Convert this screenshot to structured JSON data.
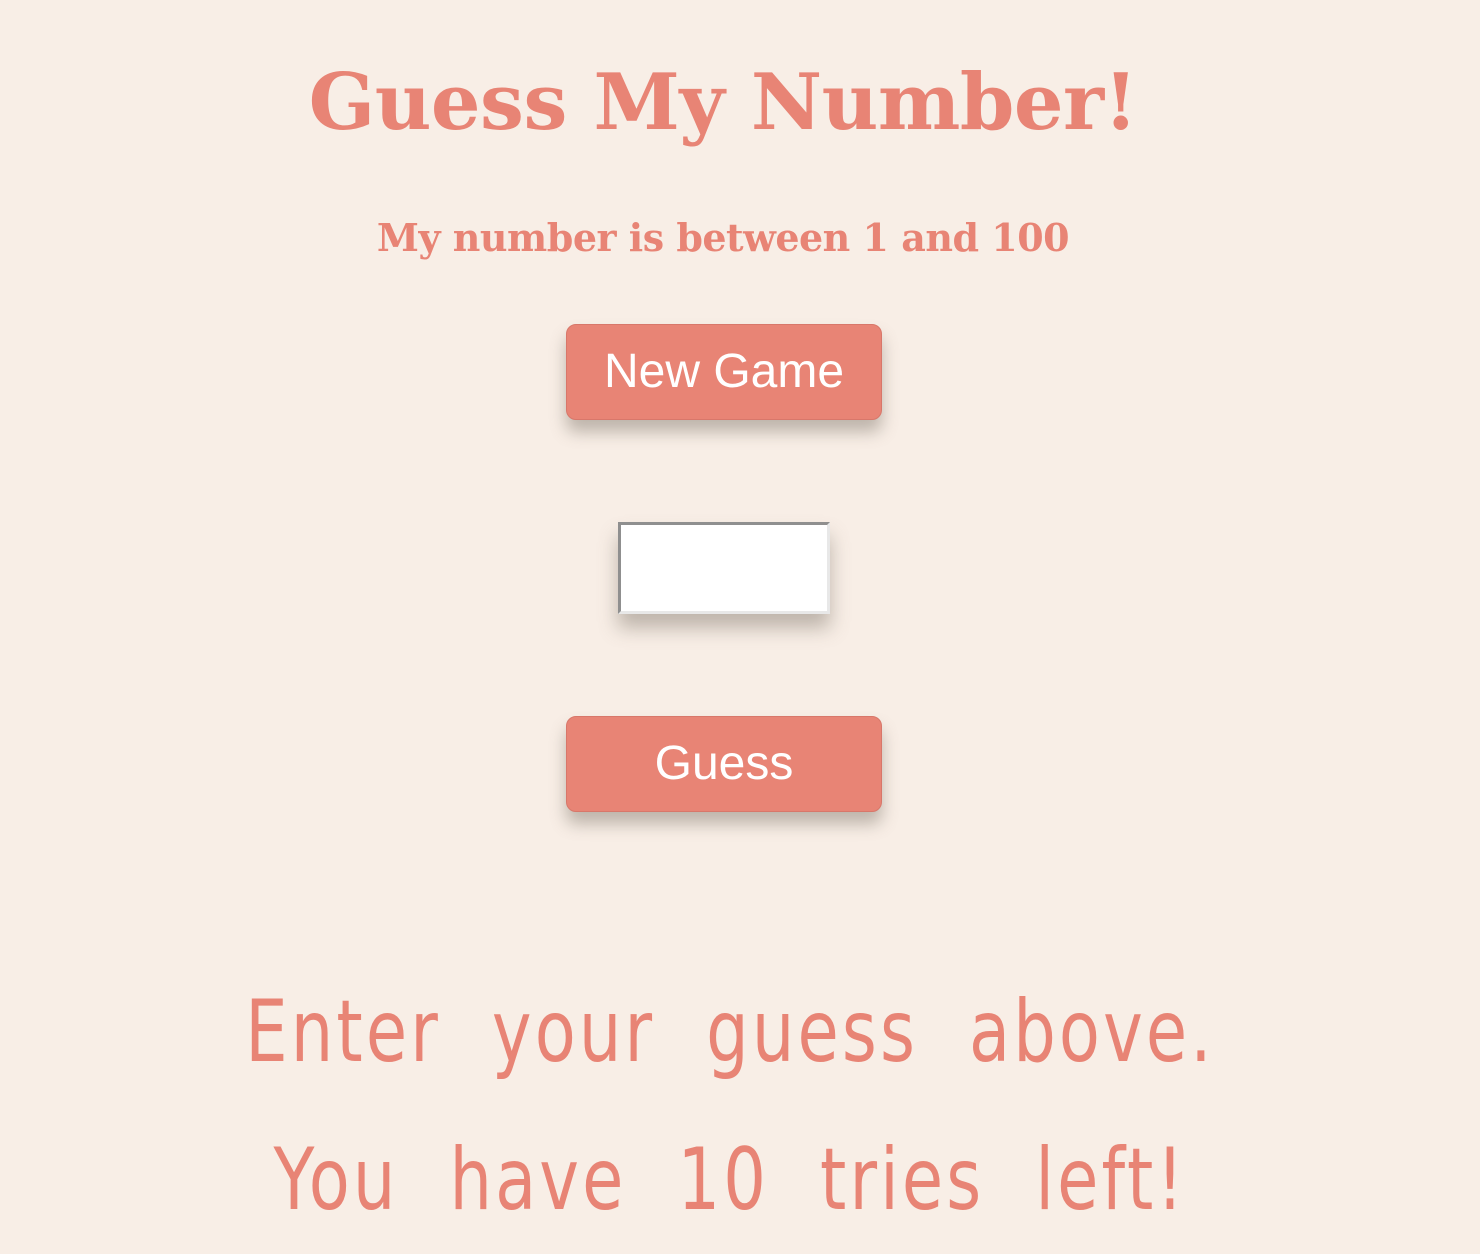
{
  "header": {
    "title": "Guess My Number!",
    "subtitle": "My number is between 1 and 100"
  },
  "controls": {
    "new_game_label": "New Game",
    "guess_input_value": "",
    "guess_label": "Guess"
  },
  "status": {
    "message": "Enter your guess above. You have 10 tries left!"
  },
  "colors": {
    "background": "#f8eee6",
    "accent": "#e88475",
    "button_text": "#ffffff"
  }
}
